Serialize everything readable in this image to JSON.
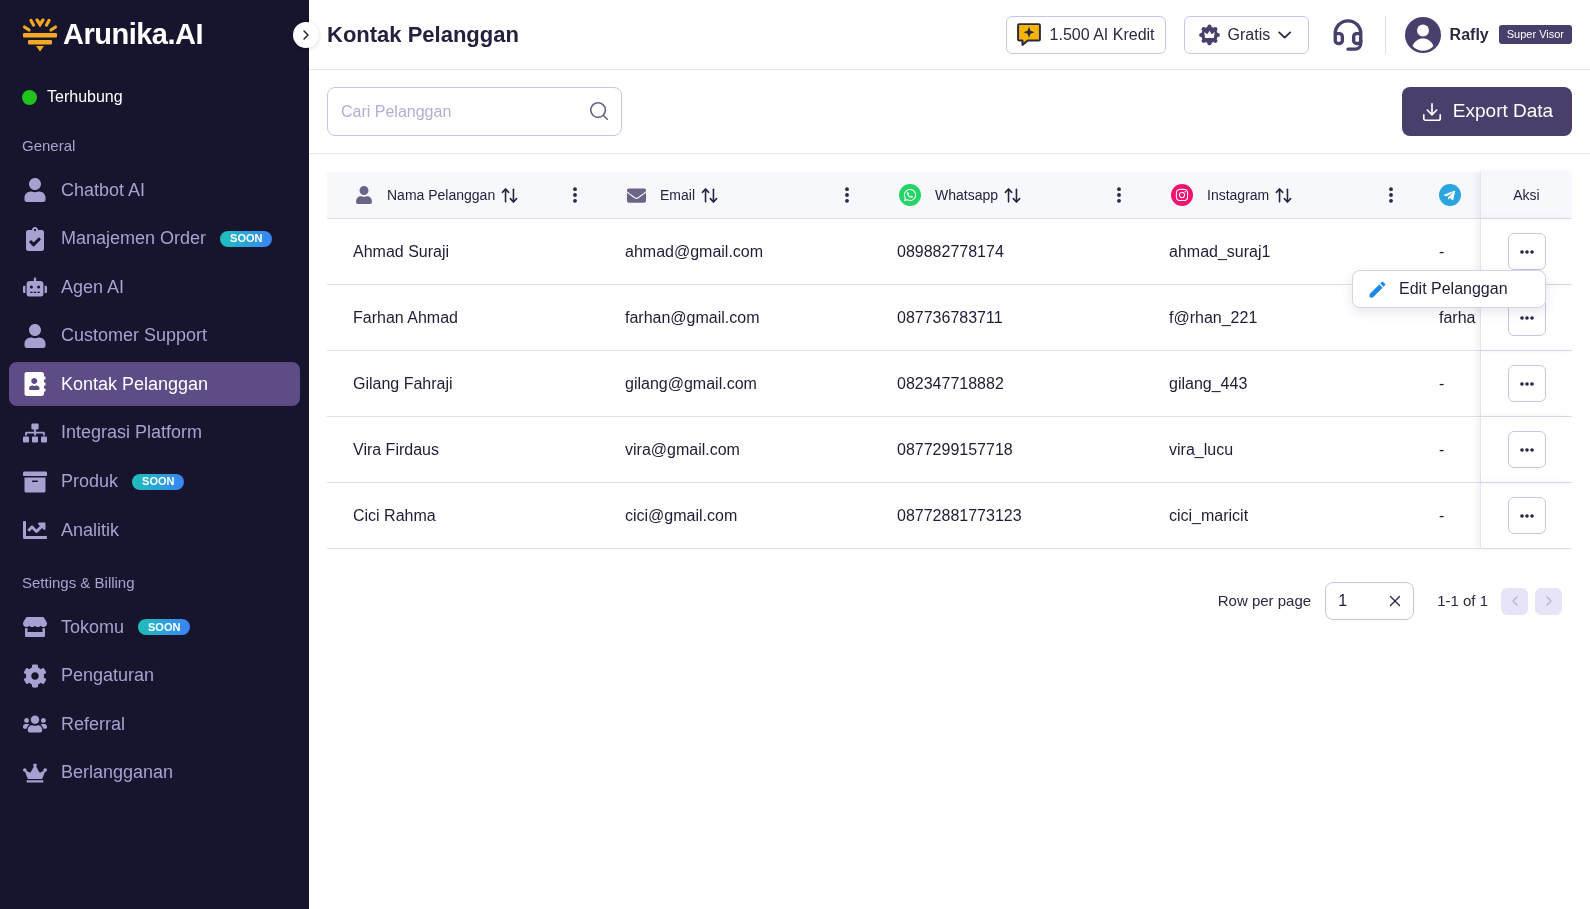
{
  "sidebar": {
    "logo": "Arunika.AI",
    "status": {
      "label": "Terhubung",
      "connected": true
    },
    "sections": [
      {
        "title": "General",
        "items": [
          {
            "label": "Chatbot AI",
            "selected": false
          },
          {
            "label": "Manajemen Order",
            "selected": false,
            "badge": "SOON"
          },
          {
            "label": "Agen AI",
            "selected": false
          },
          {
            "label": "Customer Support",
            "selected": false
          },
          {
            "label": "Kontak Pelanggan",
            "selected": true
          },
          {
            "label": "Integrasi Platform",
            "selected": false
          },
          {
            "label": "Produk",
            "selected": false,
            "badge": "SOON"
          },
          {
            "label": "Analitik",
            "selected": false
          }
        ]
      },
      {
        "title": "Settings & Billing",
        "items": [
          {
            "label": "Tokomu",
            "selected": false,
            "badge": "SOON"
          },
          {
            "label": "Pengaturan",
            "selected": false
          },
          {
            "label": "Referral",
            "selected": false
          },
          {
            "label": "Berlangganan",
            "selected": false
          }
        ]
      }
    ]
  },
  "header": {
    "title": "Kontak Pelanggan",
    "credits": "1.500 AI Kredit",
    "plan": "Gratis",
    "user": {
      "name": "Rafly",
      "role": "Super Visor"
    }
  },
  "toolbar": {
    "search": {
      "placeholder": "Cari Pelanggan"
    },
    "export_button": "Export Data"
  },
  "table": {
    "columns": [
      "Nama Pelanggan",
      "Email",
      "Whatsapp",
      "Instagram"
    ],
    "actions_column": "Aksi",
    "rows": [
      {
        "cells": [
          "Ahmad Suraji",
          "ahmad@gmail.com",
          "089882778174",
          "ahmad_suraj1",
          "-"
        ],
        "menu_open": true
      },
      {
        "cells": [
          "Farhan Ahmad",
          "farhan@gmail.com",
          "087736783711",
          "f@rhan_221",
          "farha"
        ],
        "menu_open": false
      },
      {
        "cells": [
          "Gilang Fahraji",
          "gilang@gmail.com",
          "082347718882",
          "gilang_443",
          "-"
        ],
        "menu_open": false
      },
      {
        "cells": [
          "Vira Firdaus",
          "vira@gmail.com",
          "0877299157718",
          "vira_lucu",
          "-"
        ],
        "menu_open": false
      },
      {
        "cells": [
          "Cici Rahma",
          "cici@gmail.com",
          "08772881773123",
          "cici_maricit",
          "-"
        ],
        "menu_open": false
      }
    ],
    "row_menu": [
      "Edit Pelanggan"
    ]
  },
  "pagination": {
    "rows_per_page_label": "Row per page",
    "rows_per_page": "1",
    "range": "1-1 of 1",
    "prev": {
      "disabled": true
    },
    "next": {
      "disabled": true
    }
  }
}
